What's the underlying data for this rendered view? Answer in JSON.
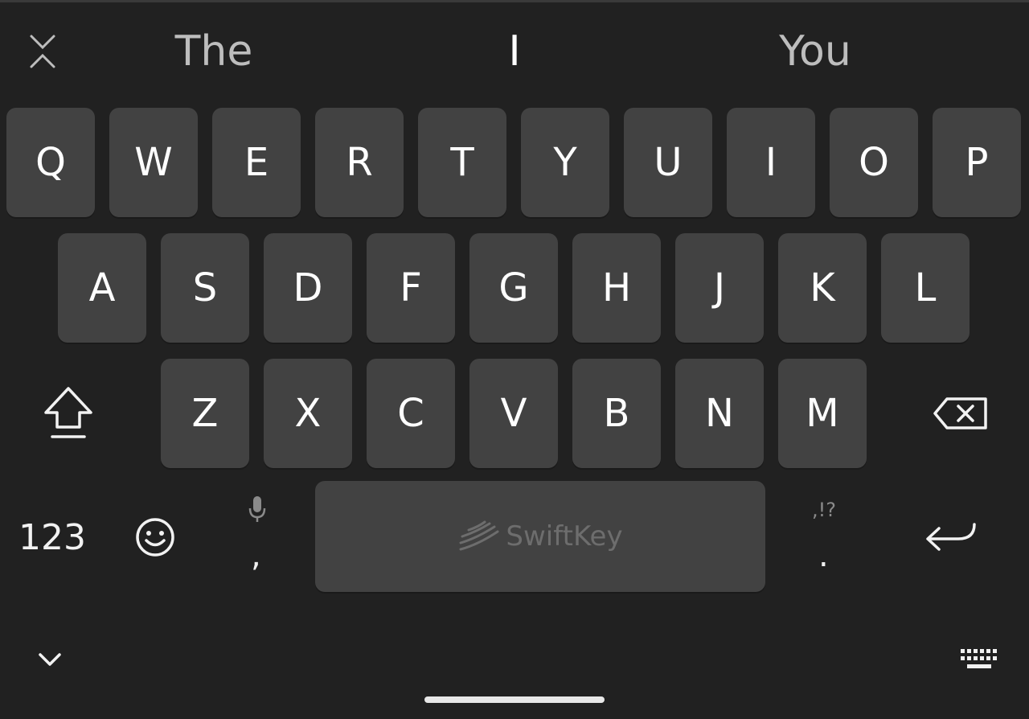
{
  "suggestions": [
    "The",
    "I",
    "You"
  ],
  "rows": [
    [
      "Q",
      "W",
      "E",
      "R",
      "T",
      "Y",
      "U",
      "I",
      "O",
      "P"
    ],
    [
      "A",
      "S",
      "D",
      "F",
      "G",
      "H",
      "J",
      "K",
      "L"
    ],
    [
      "Z",
      "X",
      "C",
      "V",
      "B",
      "N",
      "M"
    ]
  ],
  "bottom": {
    "numbers_label": "123",
    "comma_label": ",",
    "period_label": ".",
    "punct_hint": ",!?",
    "space_brand": "SwiftKey"
  },
  "colors": {
    "background": "#212121",
    "key": "#424242",
    "key_text": "#ffffff",
    "suggestion_text": "#bdbdbd"
  },
  "icons": {
    "collapse": "collapse-icon",
    "shift": "shift-icon",
    "backspace": "backspace-icon",
    "emoji": "emoji-icon",
    "mic": "microphone-icon",
    "enter": "enter-icon",
    "hide": "chevron-down-icon",
    "layout": "keyboard-icon"
  }
}
